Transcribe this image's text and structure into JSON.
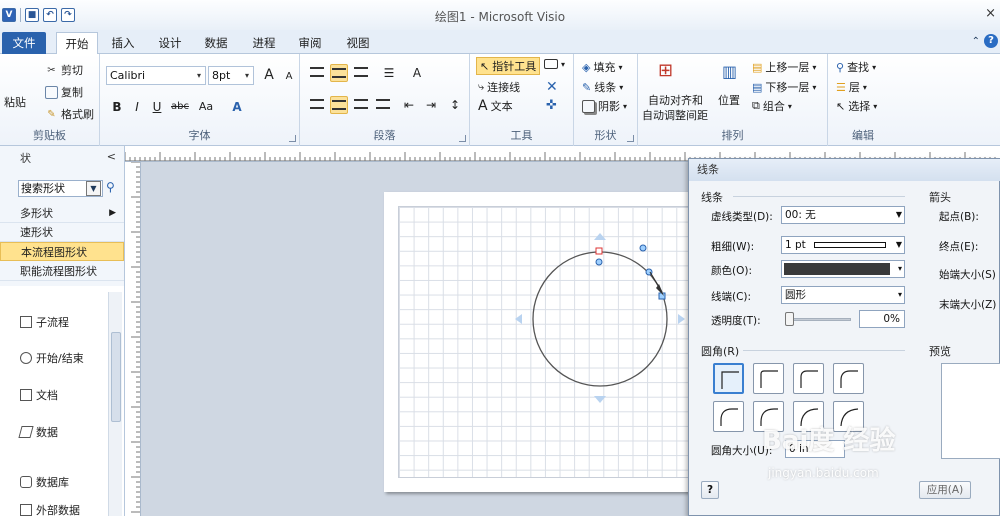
{
  "window": {
    "title": "绘图1 - Microsoft Visio",
    "close_glyph": "×"
  },
  "quick_access": {
    "logo": "V",
    "save": "■",
    "undo": "↶",
    "redo": "↷"
  },
  "tabs": [
    {
      "label": "文件"
    },
    {
      "label": "开始"
    },
    {
      "label": "插入"
    },
    {
      "label": "设计"
    },
    {
      "label": "数据"
    },
    {
      "label": "进程"
    },
    {
      "label": "审阅"
    },
    {
      "label": "视图"
    }
  ],
  "ribbon": {
    "clipboard": {
      "paste": "粘贴",
      "cut": "剪切",
      "copy": "复制",
      "format_painter": "格式刷",
      "label": "剪贴板"
    },
    "font": {
      "name": "Calibri",
      "size": "8pt",
      "grow": "A",
      "shrink": "A",
      "bold": "B",
      "italic": "I",
      "underline": "U",
      "strike": "abc",
      "case": "Aa",
      "color": "A",
      "label": "字体"
    },
    "paragraph": {
      "label": "段落"
    },
    "tools": {
      "pointer": "指针工具",
      "connector": "连接线",
      "text": "文本",
      "label": "工具"
    },
    "shape": {
      "fill": "填充",
      "line": "线条",
      "shadow": "阴影",
      "label": "形状"
    },
    "arrange": {
      "auto_align": "自动对齐和",
      "auto_space": "自动调整间距",
      "position": "位置",
      "bring_forward": "上移一层",
      "send_backward": "下移一层",
      "group": "组合",
      "label": "排列"
    },
    "editing": {
      "find": "查找",
      "layers": "层",
      "select": "选择",
      "label": "编辑"
    }
  },
  "shapes_pane": {
    "header": "状",
    "collapse": "<",
    "search_value": "搜索形状",
    "categories": [
      {
        "label": "多形状"
      },
      {
        "label": "速形状"
      },
      {
        "label": "本流程图形状"
      },
      {
        "label": "职能流程图形状"
      }
    ],
    "stencil": [
      {
        "label": "子流程"
      },
      {
        "label": "开始/结束"
      },
      {
        "label": "文档"
      },
      {
        "label": "数据"
      },
      {
        "label": "数据库"
      },
      {
        "label": "外部数据"
      }
    ]
  },
  "dialog": {
    "title": "线条",
    "line_section": "线条",
    "arrow_section": "箭头",
    "dash_type_label": "虚线类型(D):",
    "dash_type_value": "00: 无",
    "weight_label": "粗细(W):",
    "weight_value": "1 pt",
    "color_label": "颜色(O):",
    "cap_label": "线端(C):",
    "cap_value": "圆形",
    "transparency_label": "透明度(T):",
    "transparency_value": "0%",
    "begin_label": "起点(B):",
    "end_label": "终点(E):",
    "begin_size_label": "始端大小(S)",
    "end_size_label": "末端大小(Z)",
    "rounding_section": "圆角(R)",
    "preview_section": "预览",
    "rounding_size_label": "圆角大小(U):",
    "rounding_size_value": "0 in",
    "help_glyph": "?",
    "apply_label": "应用(A)"
  },
  "watermark": {
    "brand": "Bai度 经验",
    "url": "jingyan.baidu.com"
  },
  "colors": {
    "accent": "#2a62ad",
    "selection": "#ffe28e",
    "canvas_bg": "#cfd7e2"
  }
}
